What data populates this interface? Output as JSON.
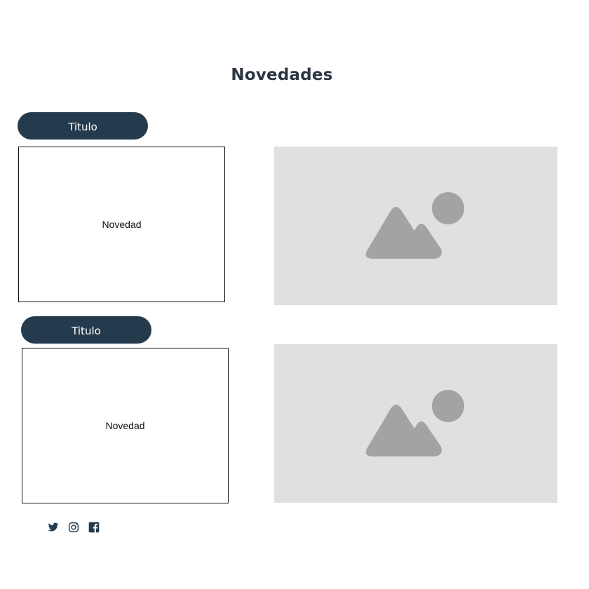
{
  "page": {
    "title": "Novedades"
  },
  "news": [
    {
      "title_label": "Titulo",
      "body_text": "Novedad",
      "image_icon": "image-placeholder-icon"
    },
    {
      "title_label": "Titulo",
      "body_text": "Novedad",
      "image_icon": "image-placeholder-icon"
    }
  ],
  "social": [
    {
      "icon": "twitter-icon"
    },
    {
      "icon": "instagram-icon"
    },
    {
      "icon": "facebook-icon"
    }
  ],
  "colors": {
    "title_text": "#2b3642",
    "pill_background": "#243b4d",
    "pill_text": "#ffffff",
    "image_placeholder_bg": "#e0e0e0",
    "image_placeholder_icon": "#a3a3a3",
    "social_icon": "#243b4d"
  }
}
